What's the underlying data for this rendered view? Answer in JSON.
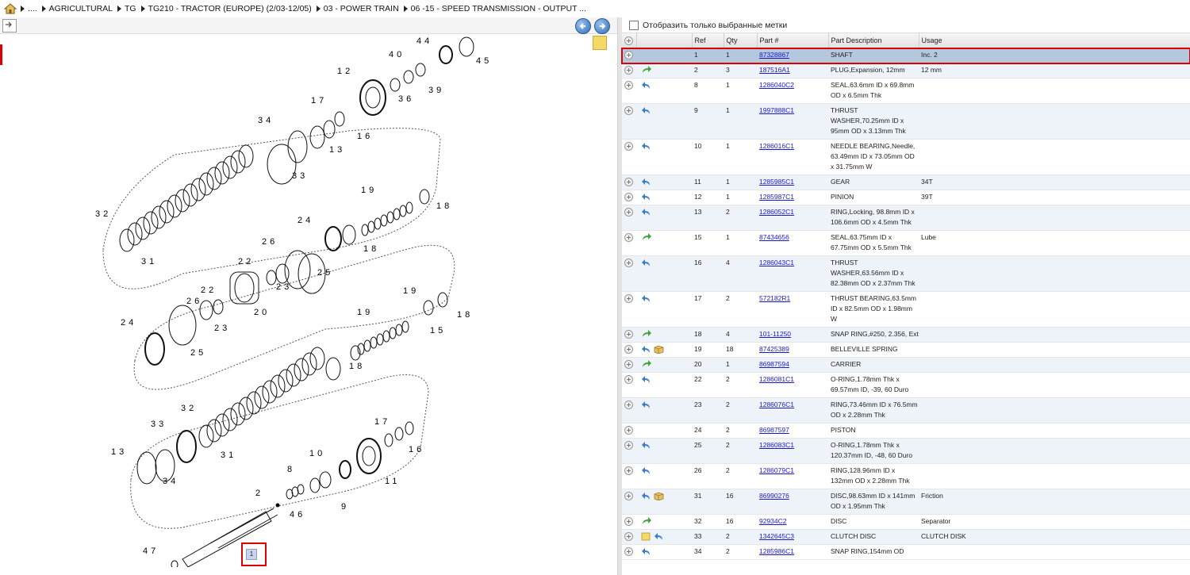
{
  "breadcrumb": [
    "....",
    "AGRICULTURAL",
    "TG",
    "TG210 - TRACTOR (EUROPE) (2/03-12/05)",
    "03 - POWER TRAIN",
    "06 -15 - SPEED TRANSMISSION - OUTPUT ..."
  ],
  "filter": {
    "label": "Отобразить только выбранные метки",
    "checked": false
  },
  "columns": {
    "ref": "Ref",
    "qty": "Qty",
    "part": "Part #",
    "desc": "Part Description",
    "usage": "Usage"
  },
  "rows": [
    {
      "ref": "1",
      "qty": "1",
      "part": "87328867",
      "desc": "SHAFT",
      "usage": "Inc. 2",
      "icons": [],
      "selected": true
    },
    {
      "ref": "2",
      "qty": "3",
      "part": "187516A1",
      "desc": "PLUG,Expansion, 12mm",
      "usage": "12 mm",
      "icons": [
        "green-arrow-icon"
      ]
    },
    {
      "ref": "8",
      "qty": "1",
      "part": "1286040C2",
      "desc": "SEAL,63.6mm ID x 69.8mm OD x 6.5mm Thk",
      "usage": "",
      "icons": [
        "blue-arrow-icon"
      ]
    },
    {
      "ref": "9",
      "qty": "1",
      "part": "1997888C1",
      "desc": "THRUST WASHER,70.25mm ID x 95mm OD x 3.13mm Thk",
      "usage": "",
      "icons": [
        "blue-arrow-icon"
      ]
    },
    {
      "ref": "10",
      "qty": "1",
      "part": "1286016C1",
      "desc": "NEEDLE BEARING,Needle, 63.49mm ID x 73.05mm OD x 31.75mm W",
      "usage": "",
      "icons": [
        "blue-arrow-icon"
      ]
    },
    {
      "ref": "11",
      "qty": "1",
      "part": "1285985C1",
      "desc": "GEAR",
      "usage": "34T",
      "icons": [
        "blue-arrow-icon"
      ]
    },
    {
      "ref": "12",
      "qty": "1",
      "part": "1285987C1",
      "desc": "PINION",
      "usage": "39T",
      "icons": [
        "blue-arrow-icon"
      ]
    },
    {
      "ref": "13",
      "qty": "2",
      "part": "1286052C1",
      "desc": "RING,Locking, 98.8mm ID x 106.6mm OD x 4.5mm Thk",
      "usage": "",
      "icons": [
        "blue-arrow-icon"
      ]
    },
    {
      "ref": "15",
      "qty": "1",
      "part": "87434656",
      "desc": "SEAL,63.75mm ID x 67.75mm OD x 5.5mm Thk",
      "usage": "Lube",
      "icons": [
        "green-arrow-icon"
      ]
    },
    {
      "ref": "16",
      "qty": "4",
      "part": "1286043C1",
      "desc": "THRUST WASHER,63.56mm ID x 82.38mm OD x 2.37mm Thk",
      "usage": "",
      "icons": [
        "blue-arrow-icon"
      ]
    },
    {
      "ref": "17",
      "qty": "2",
      "part": "572182R1",
      "desc": "THRUST BEARING,63.5mm ID x 82.5mm OD x 1.98mm W",
      "usage": "",
      "icons": [
        "blue-arrow-icon"
      ]
    },
    {
      "ref": "18",
      "qty": "4",
      "part": "101-11250",
      "desc": "SNAP RING,#250, 2.356, Ext",
      "usage": "",
      "icons": [
        "green-arrow-icon"
      ]
    },
    {
      "ref": "19",
      "qty": "18",
      "part": "87425389",
      "desc": "BELLEVILLE SPRING",
      "usage": "",
      "icons": [
        "blue-arrow-icon",
        "box-icon"
      ]
    },
    {
      "ref": "20",
      "qty": "1",
      "part": "86987594",
      "desc": "CARRIER",
      "usage": "",
      "icons": [
        "green-arrow-icon"
      ]
    },
    {
      "ref": "22",
      "qty": "2",
      "part": "1286081C1",
      "desc": "O-RING,1.78mm Thk x 69.57mm ID, -39, 60 Duro",
      "usage": "",
      "icons": [
        "blue-arrow-icon"
      ]
    },
    {
      "ref": "23",
      "qty": "2",
      "part": "1286076C1",
      "desc": "RING,73.46mm ID x 76.5mm OD x 2.28mm Thk",
      "usage": "",
      "icons": [
        "blue-arrow-icon"
      ]
    },
    {
      "ref": "24",
      "qty": "2",
      "part": "86987597",
      "desc": "PISTON",
      "usage": "",
      "icons": []
    },
    {
      "ref": "25",
      "qty": "2",
      "part": "1286083C1",
      "desc": "O-RING,1.78mm Thk x 120.37mm ID, -48, 60 Duro",
      "usage": "",
      "icons": [
        "blue-arrow-icon"
      ]
    },
    {
      "ref": "26",
      "qty": "2",
      "part": "1286079C1",
      "desc": "RING,128.96mm ID x 132mm OD x 2.28mm Thk",
      "usage": "",
      "icons": [
        "blue-arrow-icon"
      ]
    },
    {
      "ref": "31",
      "qty": "16",
      "part": "86990276",
      "desc": "DISC,98.63mm ID x 141mm OD x 1.95mm Thk",
      "usage": "Friction",
      "icons": [
        "blue-arrow-icon",
        "box-icon"
      ]
    },
    {
      "ref": "32",
      "qty": "16",
      "part": "92934C2",
      "desc": "DISC",
      "usage": "Separator",
      "icons": [
        "green-arrow-icon"
      ]
    },
    {
      "ref": "33",
      "qty": "2",
      "part": "1342645C3",
      "desc": "CLUTCH DISC",
      "usage": "CLUTCH DISK",
      "icons": [
        "note-icon",
        "blue-arrow-icon"
      ]
    },
    {
      "ref": "34",
      "qty": "2",
      "part": "1285986C1",
      "desc": "SNAP RING,154mm OD",
      "usage": "",
      "icons": [
        "blue-arrow-icon"
      ]
    }
  ],
  "diagram": {
    "callouts": [
      "44",
      "45",
      "40",
      "39",
      "36",
      "12",
      "17",
      "16",
      "13",
      "34",
      "33",
      "19",
      "18",
      "32",
      "31",
      "24",
      "18",
      "26",
      "25",
      "22",
      "23",
      "20",
      "22",
      "26",
      "23",
      "24",
      "25",
      "19",
      "15",
      "18",
      "19",
      "18",
      "32",
      "31",
      "33",
      "34",
      "13",
      "17",
      "16",
      "10",
      "11",
      "8",
      "9",
      "2",
      "46",
      "47",
      "1"
    ],
    "selected_ref": "1"
  },
  "colors": {
    "selected_row": "#b3c7dd",
    "alt_row": "#eef3f9",
    "highlight": "#dd0000",
    "link": "#1a1acc"
  }
}
